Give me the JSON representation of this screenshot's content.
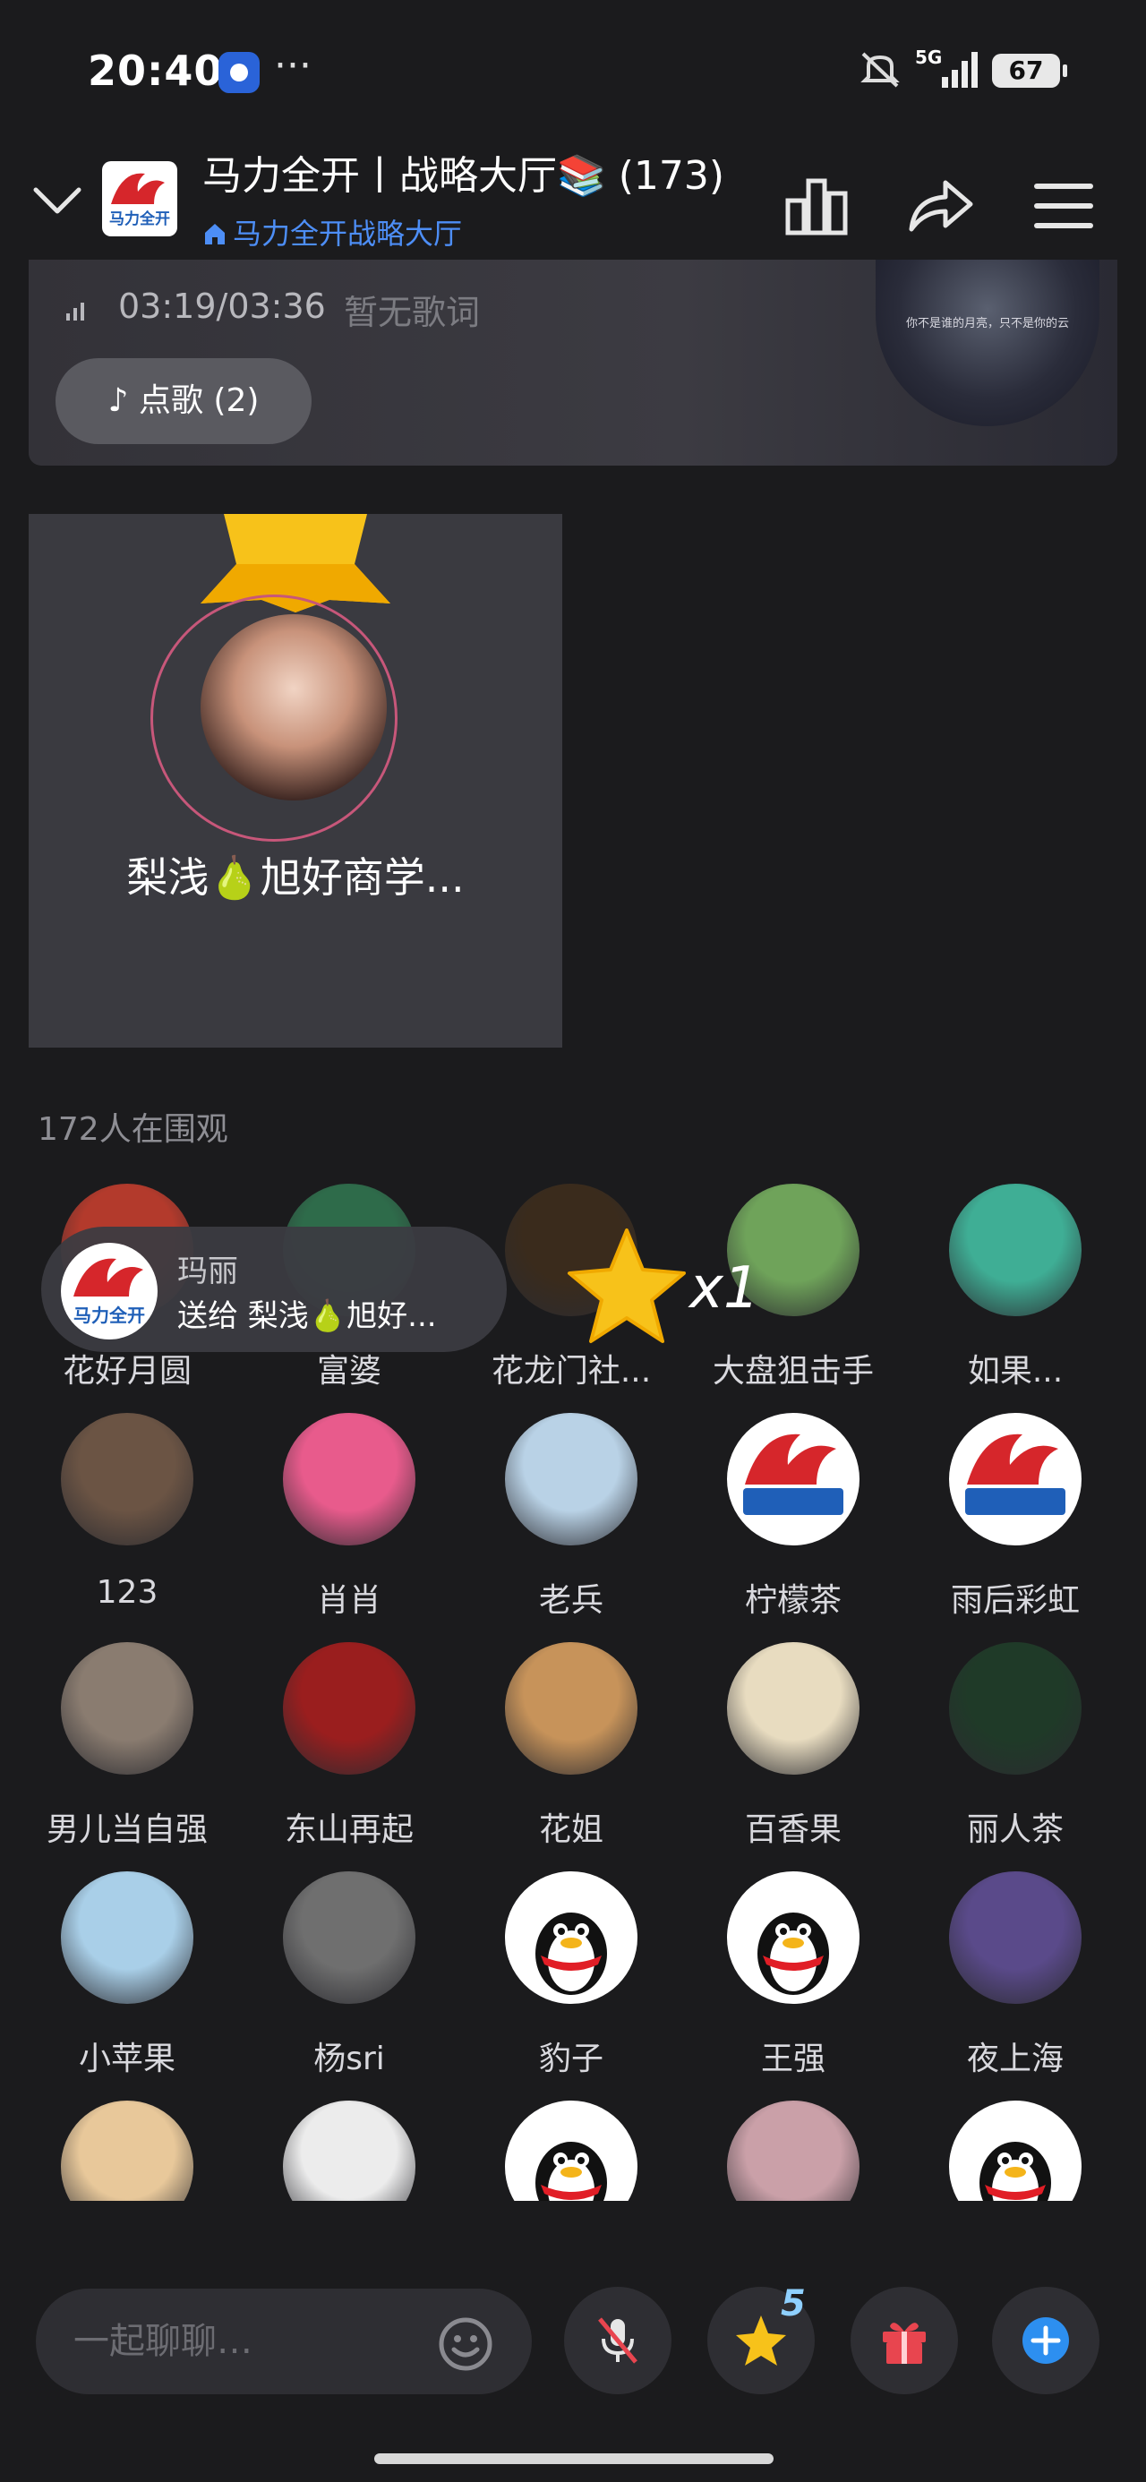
{
  "status_bar": {
    "time": "20:40",
    "more": "···",
    "network": "5G",
    "battery": "67"
  },
  "header": {
    "title": "马力全开丨战略大厅📚 (173)",
    "subtitle": "马力全开战略大厅",
    "logo_text": "马力全开"
  },
  "music": {
    "time": "03:19/03:36",
    "lyrics": "暂无歌词",
    "song_button": "点歌 (2)",
    "album_caption": "你不是谁的月亮，只不是你的云"
  },
  "host": {
    "name": "梨浅🍐旭好商学..."
  },
  "audience": {
    "watch_count": "172人在围观",
    "members": [
      {
        "name": "花好月圆",
        "avatar": "woman-avatar",
        "color": "#b33a2c"
      },
      {
        "name": "富婆",
        "avatar": "red-lips-avatar",
        "color": "#2e6b4a"
      },
      {
        "name": "花龙门社...",
        "avatar": "calligraphy-avatar",
        "color": "#3a2b1c"
      },
      {
        "name": "大盘狙击手",
        "avatar": "cartoon-tiger-avatar",
        "color": "#6fa35a"
      },
      {
        "name": "如果...",
        "avatar": "cartoon-girl-avatar",
        "color": "#3fae95"
      },
      {
        "name": "123",
        "avatar": "young-man-avatar",
        "color": "#6b5444"
      },
      {
        "name": "肖肖",
        "avatar": "pixel-girl-avatar",
        "color": "#e85b8c"
      },
      {
        "name": "老兵",
        "avatar": "glasses-man-avatar",
        "color": "#b9d2e6"
      },
      {
        "name": "柠檬茶",
        "avatar": "mali-logo-avatar",
        "color": "#ffffff"
      },
      {
        "name": "雨后彩虹",
        "avatar": "mali-logo-avatar",
        "color": "#ffffff"
      },
      {
        "name": "男儿当自强",
        "avatar": "portrait-man-avatar",
        "color": "#8a7c70"
      },
      {
        "name": "东山再起",
        "avatar": "red-pattern-avatar",
        "color": "#9a1e1e"
      },
      {
        "name": "花姐",
        "avatar": "illustrated-woman-avatar",
        "color": "#c7935a"
      },
      {
        "name": "百香果",
        "avatar": "fruit-juice-avatar",
        "color": "#e8dcc0"
      },
      {
        "name": "丽人茶",
        "avatar": "teapot-avatar",
        "color": "#1f3a28"
      },
      {
        "name": "小苹果",
        "avatar": "cartoon-boy-avatar",
        "color": "#a9cfe8"
      },
      {
        "name": "杨sri",
        "avatar": "sitting-man-avatar",
        "color": "#6f6f6f"
      },
      {
        "name": "豹子",
        "avatar": "qq-penguin-avatar",
        "color": "#ffffff"
      },
      {
        "name": "王强",
        "avatar": "qq-penguin-avatar",
        "color": "#ffffff"
      },
      {
        "name": "夜上海",
        "avatar": "calligraphy-sign-avatar",
        "color": "#5a4a8a"
      },
      {
        "name": "",
        "avatar": "blonde-child-avatar",
        "color": "#e8c89a"
      },
      {
        "name": "",
        "avatar": "child-boy-avatar",
        "color": "#ececec"
      },
      {
        "name": "",
        "avatar": "qq-penguin-avatar",
        "color": "#ffffff"
      },
      {
        "name": "",
        "avatar": "flowers-avatar",
        "color": "#caa0a8"
      },
      {
        "name": "",
        "avatar": "qq-penguin-avatar",
        "color": "#ffffff"
      }
    ]
  },
  "gift_toast": {
    "sender": "玛丽",
    "text": "送给 梨浅🍐旭好...",
    "count": "x1"
  },
  "bottom_bar": {
    "input_placeholder": "一起聊聊…",
    "star_badge": "5"
  },
  "colors": {
    "background": "#1b1b1d",
    "accent_blue": "#4d8ef6",
    "host_ring": "#c7577a",
    "star": "#f7c21a",
    "gift_red": "#e8454f"
  }
}
